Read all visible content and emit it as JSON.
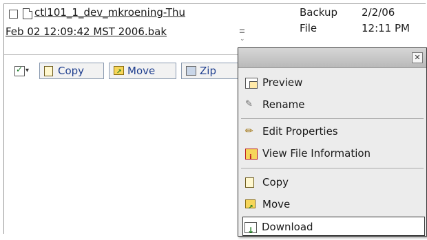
{
  "file": {
    "name_line1": "ctl101_1_dev_mkroening-Thu",
    "name_line2": "Feb 02 12:09:42 MST 2006.bak",
    "type_line1": "Backup",
    "type_line2": "File",
    "date_line1": "2/2/06",
    "date_line2": "12:11 PM"
  },
  "toolbar": {
    "copy_label": "Copy",
    "move_label": "Move",
    "zip_label": "Zip"
  },
  "menu": {
    "close_glyph": "✕",
    "items": [
      {
        "label": "Preview",
        "icon": "preview-icon"
      },
      {
        "label": "Rename",
        "icon": "rename-icon"
      },
      {
        "label": "Edit Properties",
        "icon": "pencil-icon"
      },
      {
        "label": "View File Information",
        "icon": "info-icon"
      },
      {
        "label": "Copy",
        "icon": "copy-icon"
      },
      {
        "label": "Move",
        "icon": "move-folder-icon"
      },
      {
        "label": "Download",
        "icon": "download-icon"
      }
    ]
  }
}
